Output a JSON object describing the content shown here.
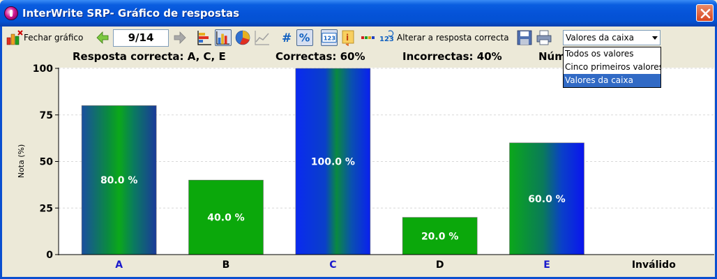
{
  "window": {
    "title": "InterWrite SRP- Gráfico de respostas"
  },
  "toolbar": {
    "close_chart_label": "Fechar gráfico",
    "counter": "9/14",
    "change_answer_label": "Alterar a resposta correcta",
    "icons": [
      "chart-close-icon",
      "prev-arrow-icon",
      "next-arrow-icon",
      "bar-chart-icon",
      "column-chart-icon",
      "pie-chart-icon",
      "line-chart-icon",
      "number-sign-icon",
      "percent-icon",
      "numbered-icon",
      "info-icon",
      "sequence-icon",
      "alter-answer-icon",
      "save-icon",
      "print-icon"
    ]
  },
  "dropdown": {
    "selected": "Valores da caixa",
    "options": [
      "Todos os valores",
      "Cinco primeiros valores",
      "Valores da caixa"
    ]
  },
  "info": {
    "correct_answer": "Resposta correcta: A, C, E",
    "correct_pct": "Correctas: 60%",
    "incorrect_pct": "Incorrectas: 40%",
    "number_partial": "Núm"
  },
  "chart_data": {
    "type": "bar",
    "ylabel": "Nota (%)",
    "ylim": [
      0,
      100
    ],
    "yticks": [
      0,
      25,
      50,
      75,
      100
    ],
    "categories": [
      "A",
      "B",
      "C",
      "D",
      "E",
      "Inválido"
    ],
    "values": [
      80,
      40,
      100,
      20,
      60,
      null
    ],
    "data_labels": [
      "80.0 %",
      "40.0 %",
      "100.0 %",
      "20.0 %",
      "60.0 %",
      ""
    ],
    "correct": [
      true,
      false,
      true,
      false,
      true,
      false
    ],
    "colors": {
      "correct_label": "#1a1acc",
      "incorrect_label": "#000000",
      "incorrect_bar": "#0ba80b",
      "grid": "#d8d8d8"
    }
  }
}
